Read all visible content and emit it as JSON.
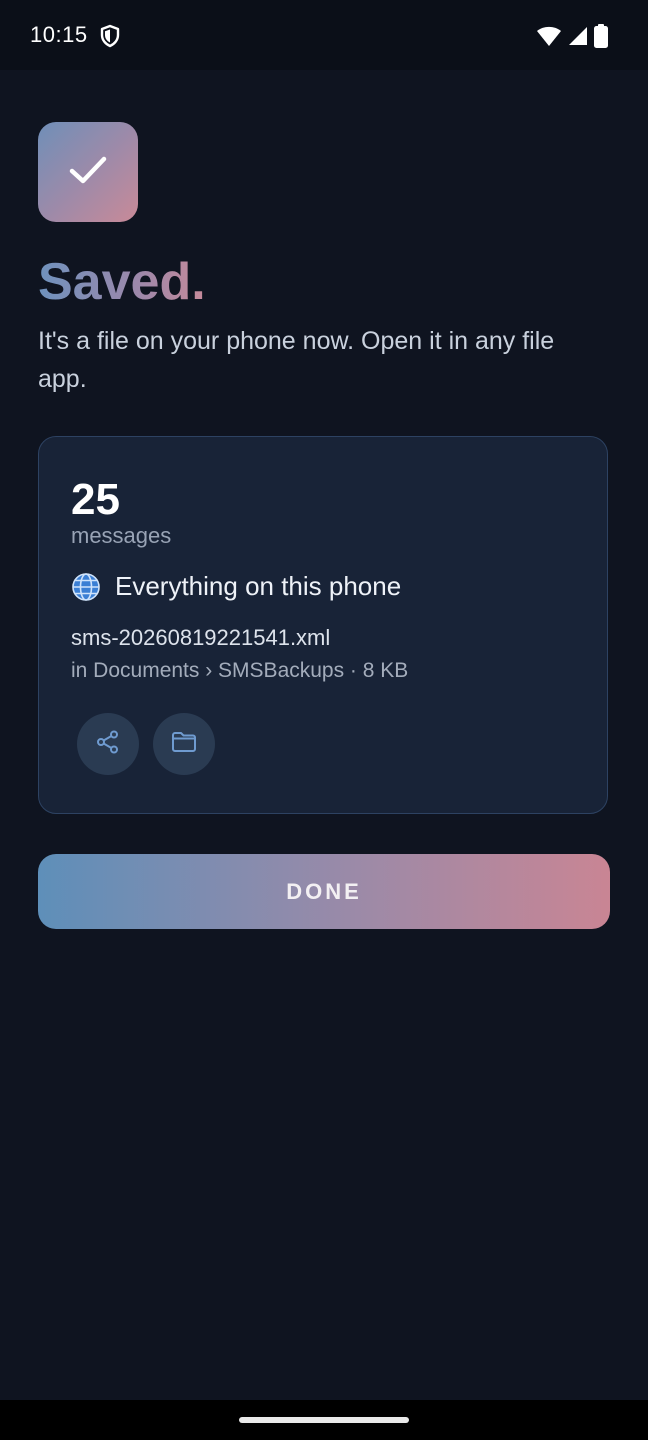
{
  "status_bar": {
    "time": "10:15",
    "icons": [
      "shield-icon",
      "wifi-icon",
      "signal-icon",
      "battery-icon"
    ]
  },
  "header": {
    "icon": "check-icon",
    "title": "Saved.",
    "subtitle": "It's a file on your phone now. Open it in any file app."
  },
  "summary_card": {
    "count": "25",
    "count_label": "messages",
    "scope_icon": "globe-icon",
    "scope_text": "Everything on this phone",
    "filename": "sms-20260819221541.xml",
    "location": "in Documents › SMSBackups · 8 KB",
    "actions": [
      {
        "icon": "share-icon"
      },
      {
        "icon": "folder-icon"
      }
    ]
  },
  "done_button": {
    "label": "DONE"
  },
  "colors": {
    "background": "#0f1420",
    "card": "#182337",
    "card_border": "#2d4262",
    "gradient_start": "#6f92bd",
    "gradient_end": "#c98a98"
  }
}
